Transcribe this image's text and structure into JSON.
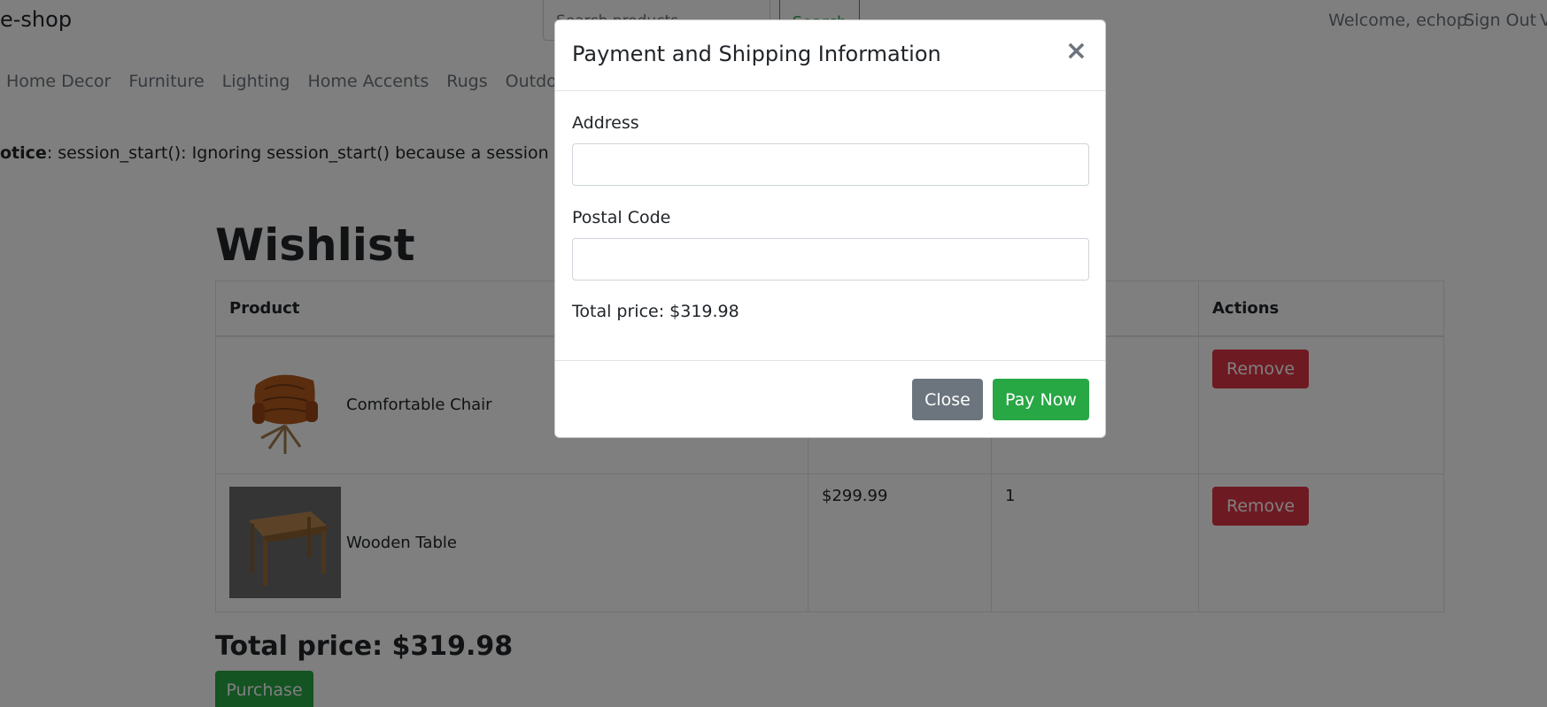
{
  "header": {
    "brand": "e-shop",
    "search_placeholder": "Search products",
    "search_button": "Search",
    "welcome": "Welcome, echop",
    "sign_out": "Sign Out",
    "edge_letter": "V"
  },
  "nav": {
    "items": [
      {
        "label": "Home Decor"
      },
      {
        "label": "Furniture"
      },
      {
        "label": "Lighting"
      },
      {
        "label": "Home Accents"
      },
      {
        "label": "Rugs"
      },
      {
        "label": "Outdoors"
      }
    ]
  },
  "notice": {
    "label": "otice",
    "text": ": session_start(): Ignoring session_start() because a session is alread"
  },
  "wishlist": {
    "title": "Wishlist",
    "columns": [
      "Product",
      "",
      "",
      "Actions"
    ],
    "rows": [
      {
        "name": "Comfortable Chair",
        "price": "",
        "qty": "",
        "action": "Remove"
      },
      {
        "name": "Wooden Table",
        "price": "$299.99",
        "qty": "1",
        "action": "Remove"
      }
    ],
    "total": "Total price: $319.98",
    "purchase": "Purchase"
  },
  "modal": {
    "title": "Payment and Shipping Information",
    "close_glyph": "×",
    "address_label": "Address",
    "address_value": "",
    "postal_label": "Postal Code",
    "postal_value": "",
    "total": "Total price: $319.98",
    "close_button": "Close",
    "pay_button": "Pay Now"
  },
  "colors": {
    "success": "#28a745",
    "danger": "#dc3545",
    "secondary": "#6c757d"
  }
}
